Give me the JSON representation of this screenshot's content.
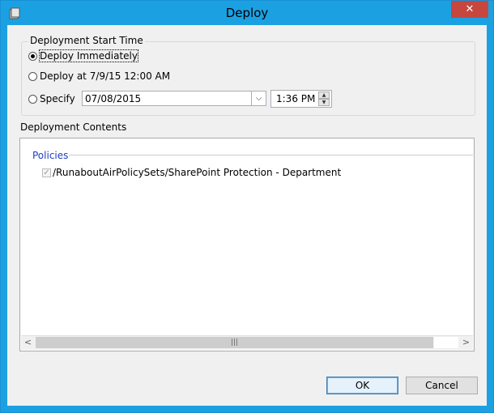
{
  "window": {
    "title": "Deploy",
    "close_label": "✕"
  },
  "start_time": {
    "group_label": "Deployment Start Time",
    "options": [
      {
        "label": "Deploy Immediately",
        "checked": true
      },
      {
        "label": "Deploy at 7/9/15 12:00 AM",
        "checked": false
      },
      {
        "label": "Specify",
        "checked": false
      }
    ],
    "date_value": "07/08/2015",
    "time_value": "1:36 PM"
  },
  "contents": {
    "label": "Deployment Contents",
    "policies_header": "Policies",
    "policies": [
      {
        "label": "/RunaboutAirPolicySets/SharePoint Protection - Department",
        "checked": true
      }
    ]
  },
  "buttons": {
    "ok": "OK",
    "cancel": "Cancel"
  },
  "colors": {
    "titlebar": "#1ba1e2",
    "close": "#c7463e",
    "group_header": "#1f3fbf"
  }
}
